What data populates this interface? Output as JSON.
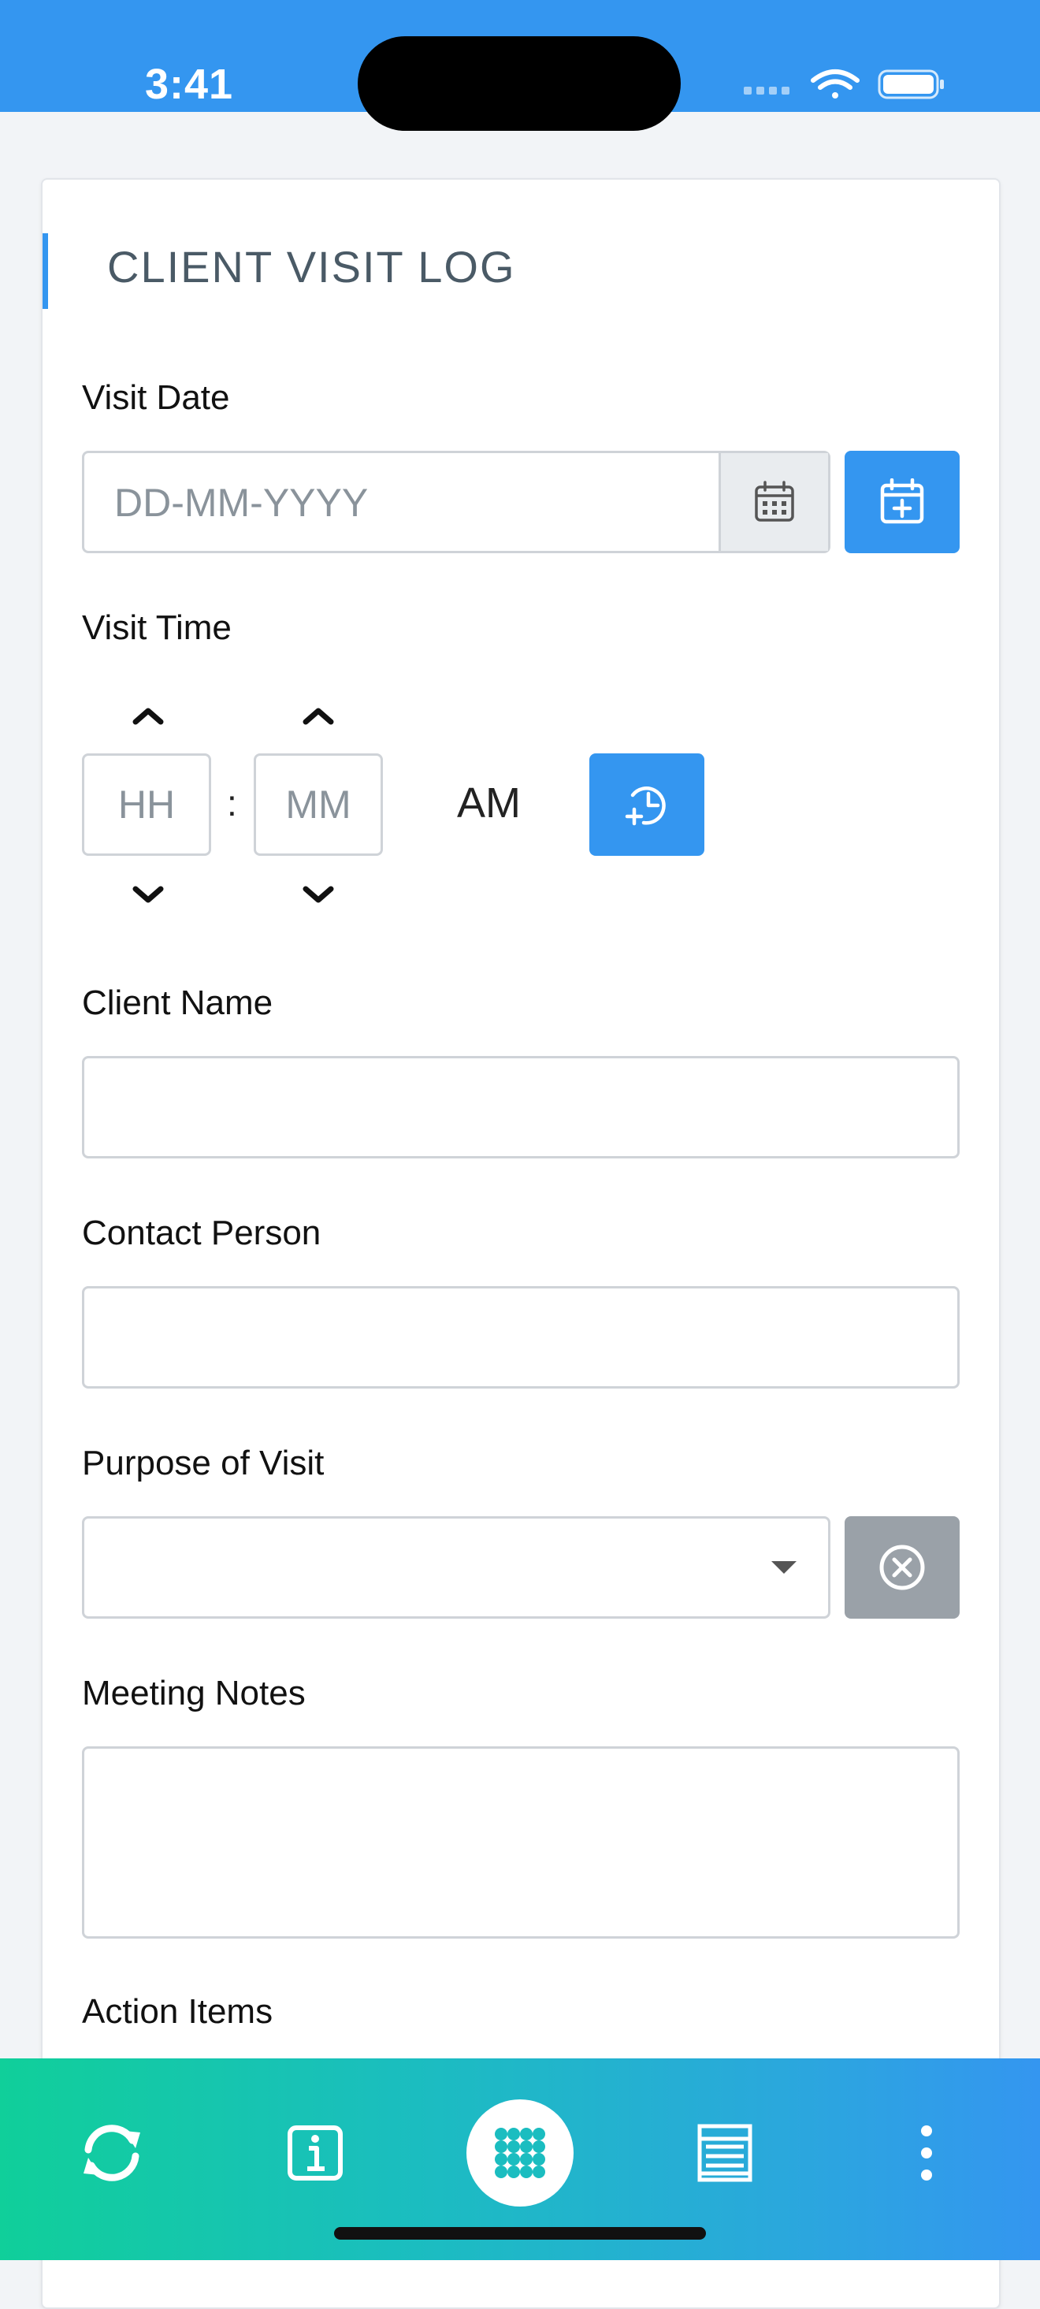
{
  "status_bar": {
    "time": "3:41"
  },
  "form": {
    "title": "CLIENT VISIT LOG",
    "visit_date": {
      "label": "Visit Date",
      "placeholder": "DD-MM-YYYY"
    },
    "visit_time": {
      "label": "Visit Time",
      "hour_placeholder": "HH",
      "minute_placeholder": "MM",
      "separator": ":",
      "meridiem": "AM"
    },
    "client_name": {
      "label": "Client Name",
      "value": ""
    },
    "contact_person": {
      "label": "Contact Person",
      "value": ""
    },
    "purpose": {
      "label": "Purpose of Visit",
      "selected": ""
    },
    "meeting_notes": {
      "label": "Meeting Notes",
      "value": ""
    },
    "action_items": {
      "label": "Action Items"
    }
  },
  "tab_bar": {
    "icons": [
      "sync-icon",
      "info-icon",
      "apps-grid-icon",
      "list-icon",
      "more-vertical-icon"
    ]
  },
  "colors": {
    "accent": "#3496f0",
    "tab_gradient_start": "#10cf9a",
    "tab_gradient_end": "#3496f0",
    "clear_button": "#9aa1a8"
  }
}
